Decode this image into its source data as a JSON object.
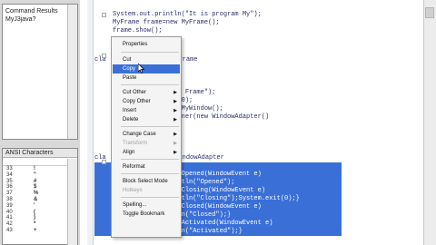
{
  "left_panel": {
    "file_items": [
      "Command Results",
      "MyJ3java?"
    ],
    "ansi_title": "ANSI Characters",
    "ansi_rows": [
      {
        "num": "33",
        "ch": "!"
      },
      {
        "num": "34",
        "ch": "\""
      },
      {
        "num": "35",
        "ch": "#"
      },
      {
        "num": "36",
        "ch": "$"
      },
      {
        "num": "37",
        "ch": "%"
      },
      {
        "num": "38",
        "ch": "&"
      },
      {
        "num": "39",
        "ch": "'"
      },
      {
        "num": "40",
        "ch": "("
      },
      {
        "num": "41",
        "ch": ")"
      },
      {
        "num": "42",
        "ch": "*"
      },
      {
        "num": "43",
        "ch": "+"
      }
    ]
  },
  "editor": {
    "lines": [
      {
        "text": "System.out.println(\"It is program My\");",
        "selected": false
      },
      {
        "text": "MyFrame frame=new MyFrame();",
        "selected": false
      },
      {
        "text": "frame.show();",
        "selected": false
      },
      {
        "text": "cla                  JFrame",
        "selected": false
      },
      {
        "text": "                in Frame\");",
        "selected": false
      },
      {
        "text": "                200);",
        "selected": false
      },
      {
        "text": "                w MyWindow();",
        "selected": false
      },
      {
        "text": "                tener(new WindowAdapter()",
        "selected": false
      },
      {
        "text": "cla                e WindowAdapter",
        "selected": false
      },
      {
        "text": "                owOpened(WindowEvent e)",
        "selected": true
      },
      {
        "text": "                intln(\"Opened\");",
        "selected": true
      },
      {
        "text": "                owClosing(WindowEvent e)",
        "selected": true
      },
      {
        "text": "                intln(\"Closing\");System.exit(0);}",
        "selected": true
      },
      {
        "text": "                owClosed(WindowEvent e)",
        "selected": true
      },
      {
        "text": "{System.out.println(\"Closed\");}",
        "selected": true
      },
      {
        "text": "public void windowActivated(WindowEvent e)",
        "selected": true
      },
      {
        "text": "{System.out.println(\"Activated\");}",
        "selected": true
      }
    ]
  },
  "context_menu": {
    "items": [
      {
        "label": "Properties",
        "disabled": false,
        "submenu": false,
        "highlighted": false
      },
      {
        "label": "Cut",
        "disabled": false,
        "submenu": false,
        "highlighted": false
      },
      {
        "label": "Copy",
        "disabled": false,
        "submenu": false,
        "highlighted": true
      },
      {
        "label": "Paste",
        "disabled": false,
        "submenu": false,
        "highlighted": false
      },
      {
        "label": "Cut Other",
        "disabled": false,
        "submenu": true,
        "highlighted": false
      },
      {
        "label": "Copy Other",
        "disabled": false,
        "submenu": true,
        "highlighted": false
      },
      {
        "label": "Insert",
        "disabled": false,
        "submenu": true,
        "highlighted": false
      },
      {
        "label": "Delete",
        "disabled": false,
        "submenu": true,
        "highlighted": false
      },
      {
        "label": "Change Case",
        "disabled": false,
        "submenu": true,
        "highlighted": false
      },
      {
        "label": "Transform",
        "disabled": true,
        "submenu": true,
        "highlighted": false
      },
      {
        "label": "Align",
        "disabled": false,
        "submenu": true,
        "highlighted": false
      },
      {
        "label": "Reformat",
        "disabled": false,
        "submenu": false,
        "highlighted": false
      },
      {
        "label": "Block Select Mode",
        "disabled": false,
        "submenu": false,
        "highlighted": false
      },
      {
        "label": "Hotkeys",
        "disabled": true,
        "submenu": false,
        "highlighted": false
      },
      {
        "label": "Spelling...",
        "disabled": false,
        "submenu": false,
        "highlighted": false
      },
      {
        "label": "Toggle Bookmark",
        "disabled": false,
        "submenu": false,
        "highlighted": false
      }
    ]
  },
  "colors": {
    "selection": "#3a6fd8",
    "code": "#2a2f6a",
    "menu_bg": "#f4f4f4"
  }
}
